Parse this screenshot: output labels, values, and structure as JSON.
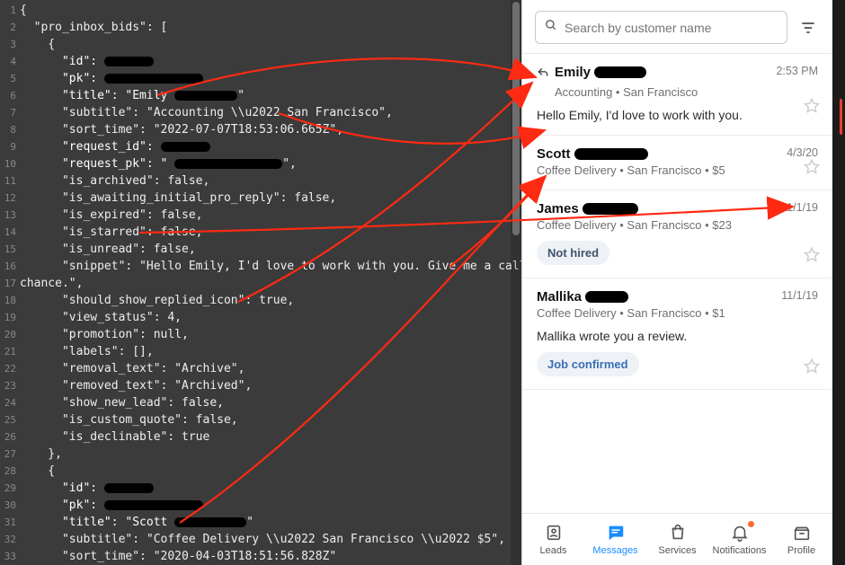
{
  "code": {
    "lines": [
      {
        "n": 1,
        "indent": 0,
        "raw": "{"
      },
      {
        "n": 2,
        "indent": 1,
        "raw": "\"pro_inbox_bids\": ["
      },
      {
        "n": 3,
        "indent": 2,
        "raw": "{"
      },
      {
        "n": 4,
        "indent": 3,
        "kv": true,
        "k": "\"id\":",
        "redact": 55,
        "tail": ""
      },
      {
        "n": 5,
        "indent": 3,
        "kv": true,
        "k": "\"pk\":",
        "redact": 110,
        "tail": ""
      },
      {
        "n": 6,
        "indent": 3,
        "kv": true,
        "k": "\"title\": \"Emily",
        "redact": 70,
        "tail": "\""
      },
      {
        "n": 7,
        "indent": 3,
        "raw": "\"subtitle\": \"Accounting \\\\u2022 San Francisco\","
      },
      {
        "n": 8,
        "indent": 3,
        "raw": "\"sort_time\": \"2022-07-07T18:53:06.665Z\","
      },
      {
        "n": 9,
        "indent": 3,
        "kv": true,
        "k": "\"request_id\":",
        "redact": 55,
        "tail": ""
      },
      {
        "n": 10,
        "indent": 3,
        "kv": true,
        "k": "\"request_pk\": \"",
        "redact": 120,
        "tail": "\","
      },
      {
        "n": 11,
        "indent": 3,
        "raw": "\"is_archived\": false,"
      },
      {
        "n": 12,
        "indent": 3,
        "raw": "\"is_awaiting_initial_pro_reply\": false,"
      },
      {
        "n": 13,
        "indent": 3,
        "raw": "\"is_expired\": false,"
      },
      {
        "n": 14,
        "indent": 3,
        "raw": "\"is_starred\": false,"
      },
      {
        "n": 15,
        "indent": 3,
        "raw": "\"is_unread\": false,"
      },
      {
        "n": 16,
        "indent": 3,
        "raw": "\"snippet\": \"Hello Emily, I'd love to work with you. Give me a call when you have a"
      },
      {
        "n": 17,
        "indent": 0,
        "raw": "chance.\","
      },
      {
        "n": 18,
        "indent": 3,
        "raw": "\"should_show_replied_icon\": true,"
      },
      {
        "n": 19,
        "indent": 3,
        "raw": "\"view_status\": 4,"
      },
      {
        "n": 20,
        "indent": 3,
        "raw": "\"promotion\": null,"
      },
      {
        "n": 21,
        "indent": 3,
        "raw": "\"labels\": [],"
      },
      {
        "n": 22,
        "indent": 3,
        "raw": "\"removal_text\": \"Archive\","
      },
      {
        "n": 23,
        "indent": 3,
        "raw": "\"removed_text\": \"Archived\","
      },
      {
        "n": 24,
        "indent": 3,
        "raw": "\"show_new_lead\": false,"
      },
      {
        "n": 25,
        "indent": 3,
        "raw": "\"is_custom_quote\": false,"
      },
      {
        "n": 26,
        "indent": 3,
        "raw": "\"is_declinable\": true"
      },
      {
        "n": 27,
        "indent": 2,
        "raw": "},"
      },
      {
        "n": 28,
        "indent": 2,
        "raw": "{"
      },
      {
        "n": 29,
        "indent": 3,
        "kv": true,
        "k": "\"id\":",
        "redact": 55,
        "tail": ""
      },
      {
        "n": 30,
        "indent": 3,
        "kv": true,
        "k": "\"pk\":",
        "redact": 110,
        "tail": ""
      },
      {
        "n": 31,
        "indent": 3,
        "kv": true,
        "k": "\"title\": \"Scott",
        "redact": 80,
        "tail": "\""
      },
      {
        "n": 32,
        "indent": 3,
        "raw": "\"subtitle\": \"Coffee Delivery \\\\u2022 San Francisco \\\\u2022 $5\","
      },
      {
        "n": 33,
        "indent": 3,
        "raw": "\"sort_time\": \"2020-04-03T18:51:56.828Z\""
      }
    ]
  },
  "search": {
    "placeholder": "Search by customer name"
  },
  "inbox": [
    {
      "name": "Emily",
      "name_redact_w": 58,
      "time": "2:53 PM",
      "subtitle": "Accounting • San Francisco",
      "snippet": "Hello Emily, I'd love to work with you.",
      "replied": true,
      "pill": null
    },
    {
      "name": "Scott",
      "name_redact_w": 82,
      "time": "4/3/20",
      "subtitle": "Coffee Delivery • San Francisco • $5",
      "snippet": "",
      "replied": false,
      "pill": null
    },
    {
      "name": "James",
      "name_redact_w": 62,
      "time": "11/1/19",
      "subtitle": "Coffee Delivery • San Francisco • $23",
      "snippet": "",
      "replied": false,
      "pill": "Not hired"
    },
    {
      "name": "Mallika",
      "name_redact_w": 48,
      "time": "11/1/19",
      "subtitle": "Coffee Delivery • San Francisco • $1",
      "snippet": "Mallika wrote you a review.",
      "replied": false,
      "pill": "Job confirmed",
      "pill_class": "confirmed"
    }
  ],
  "tabs": {
    "leads": "Leads",
    "messages": "Messages",
    "services": "Services",
    "notifications": "Notifications",
    "profile": "Profile"
  }
}
